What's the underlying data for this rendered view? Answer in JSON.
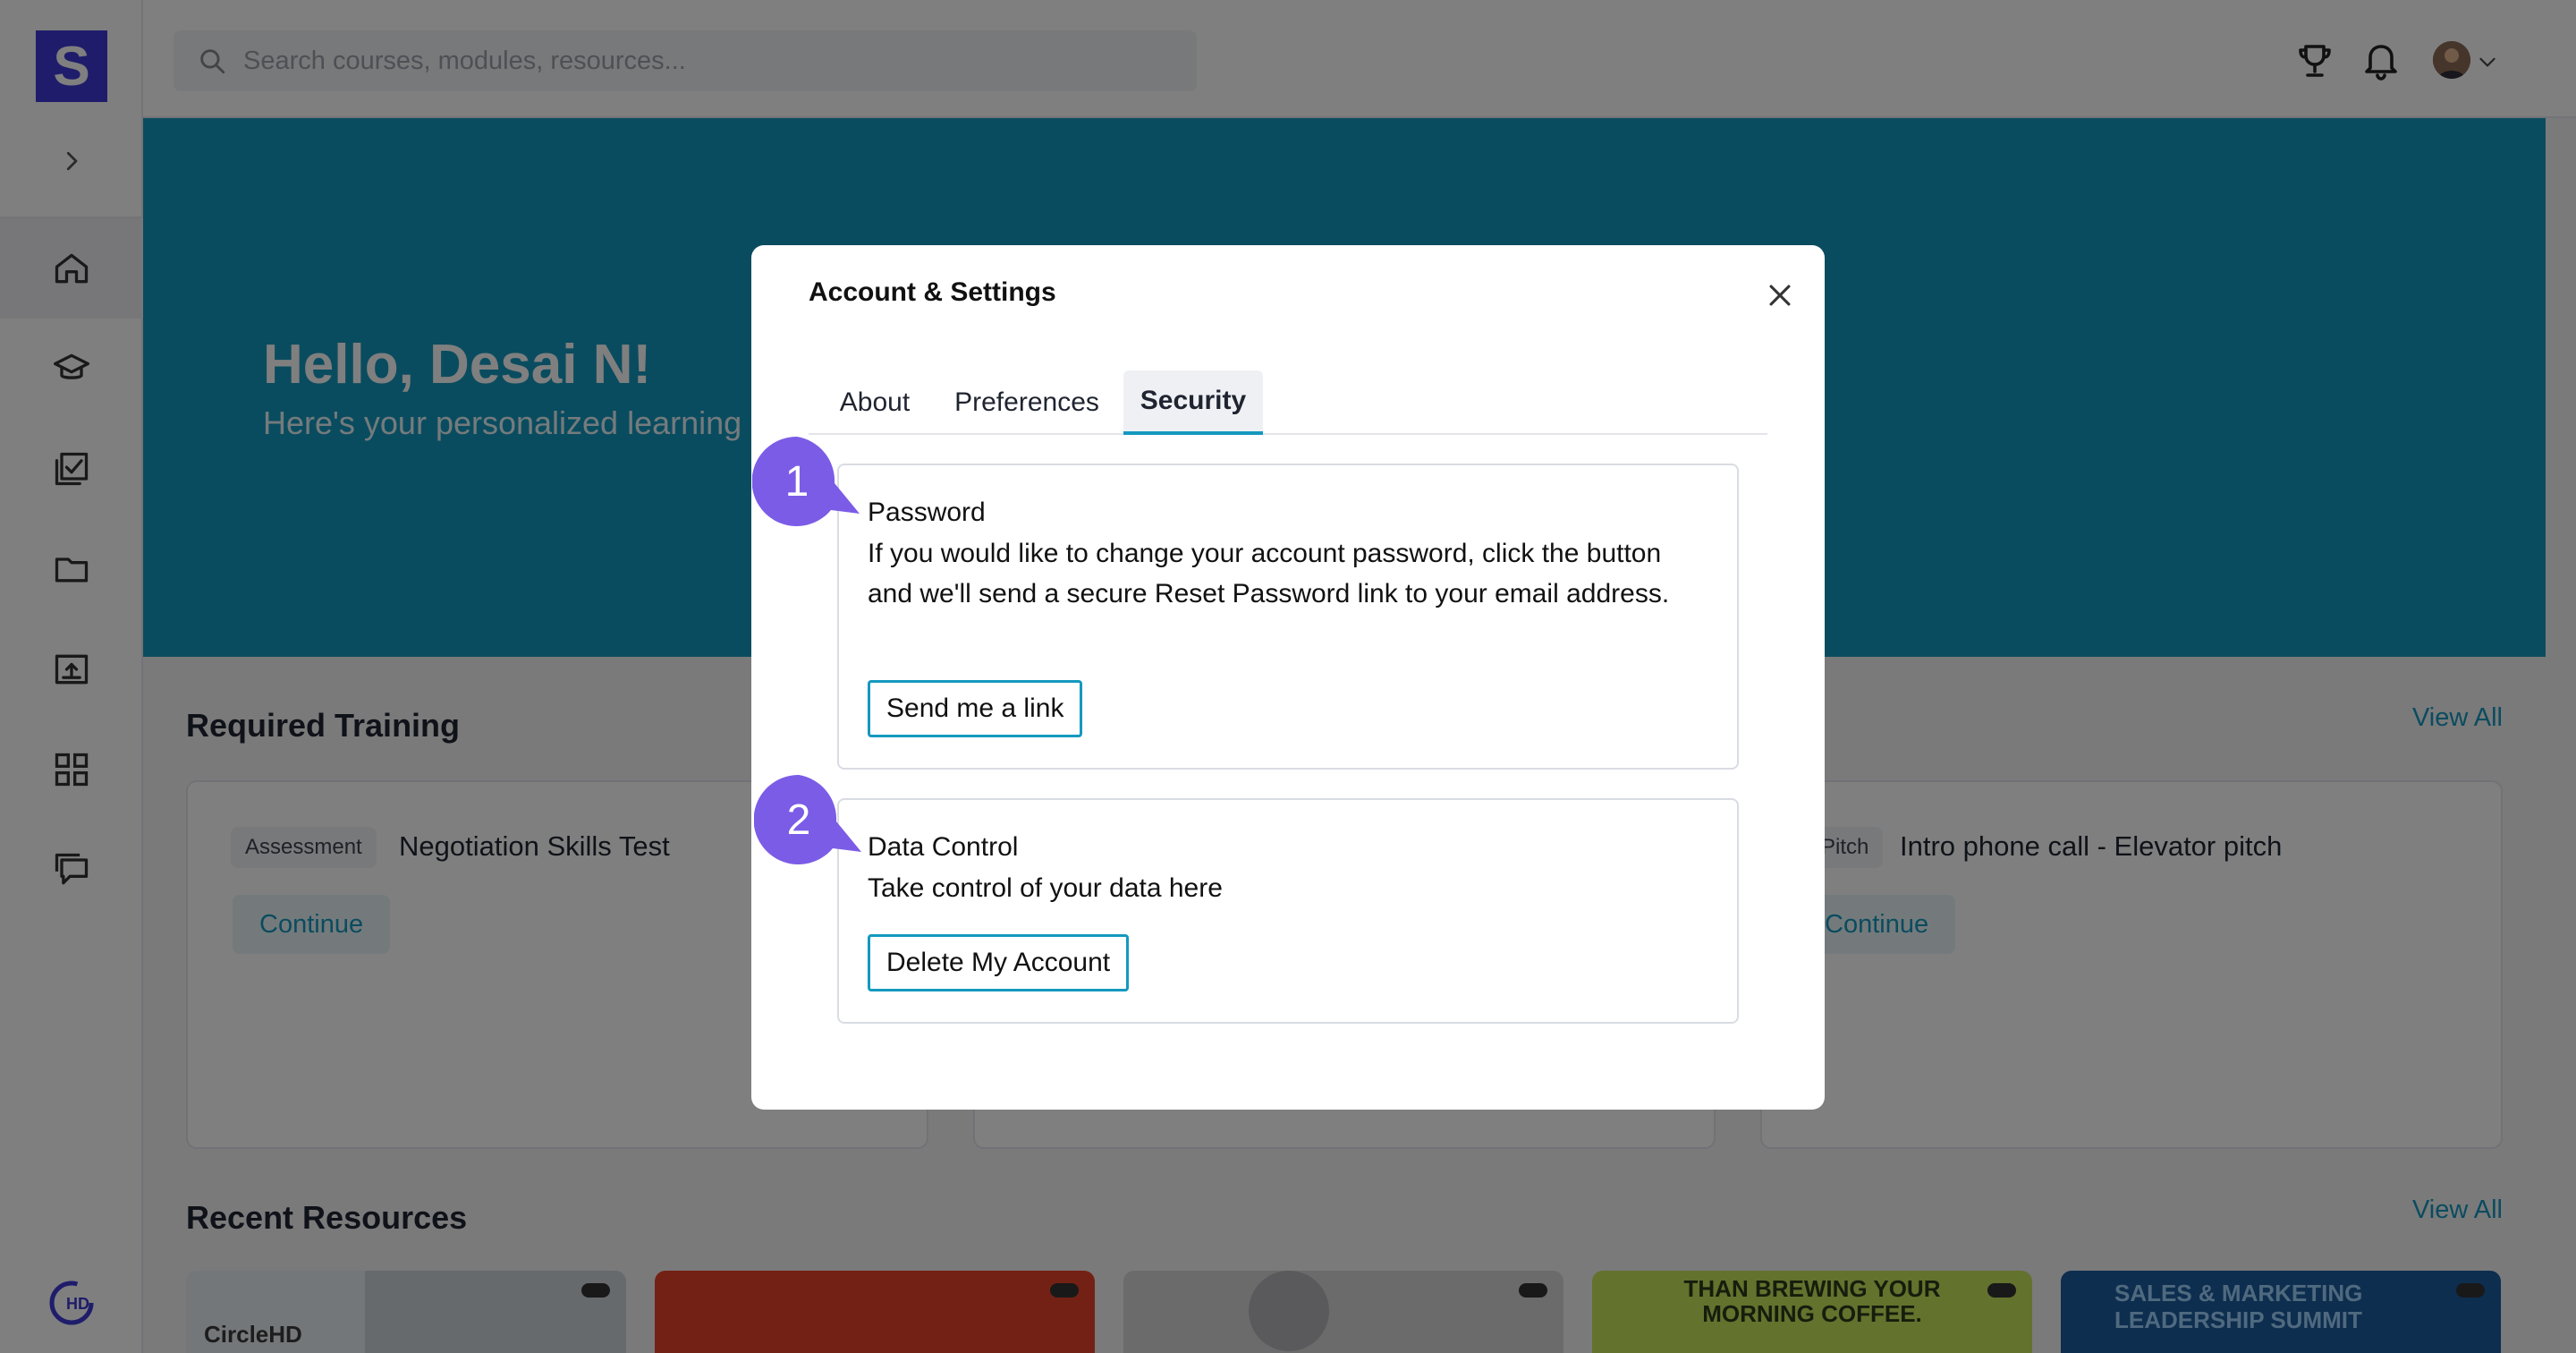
{
  "app": {
    "logo_letter": "S"
  },
  "search": {
    "placeholder": "Search courses, modules, resources..."
  },
  "hero": {
    "greeting": "Hello, Desai N!",
    "subtitle": "Here's your personalized learning"
  },
  "required_training": {
    "title": "Required Training",
    "view_all": "View All",
    "cards": [
      {
        "tag": "Assessment",
        "title": "Negotiation Skills Test",
        "action": "Continue"
      },
      {
        "tag": "Pitch",
        "title": "Intro phone call - Elevator pitch",
        "action": "Continue"
      }
    ]
  },
  "recent_resources": {
    "title": "Recent Resources",
    "view_all": "View All",
    "items": [
      {
        "label": "CircleHD",
        "color": "#e8eef2"
      },
      {
        "label": "",
        "color": "#e8432b"
      },
      {
        "label": "",
        "color": "#d6d6d8"
      },
      {
        "label": "THAN BREWING YOUR MORNING COFFEE.",
        "color": "#c6e45a"
      },
      {
        "label": "SALES & MARKETING LEADERSHIP SUMMIT",
        "color": "#1d5c9e"
      }
    ]
  },
  "modal": {
    "title": "Account & Settings",
    "tabs": [
      {
        "label": "About",
        "active": false
      },
      {
        "label": "Preferences",
        "active": false
      },
      {
        "label": "Security",
        "active": true
      }
    ],
    "sections": [
      {
        "step": "1",
        "title": "Password",
        "description": "If you would like to change your account password, click the button and we'll send a secure Reset Password link to your email address.",
        "button": "Send me a link"
      },
      {
        "step": "2",
        "title": "Data Control",
        "description": "Take control of your data here",
        "button": "Delete My Account"
      }
    ]
  },
  "colors": {
    "brand": "#3f3bd6",
    "accent": "#1499bf",
    "step_badge": "#7b5ce6"
  },
  "icons": {
    "sidebar": [
      "home-icon",
      "graduation-cap-icon",
      "checklist-icon",
      "folder-icon",
      "upload-icon",
      "grid-icon",
      "chat-icon"
    ],
    "topbar": [
      "trophy-icon",
      "bell-icon",
      "avatar",
      "chevron-down-icon"
    ]
  }
}
